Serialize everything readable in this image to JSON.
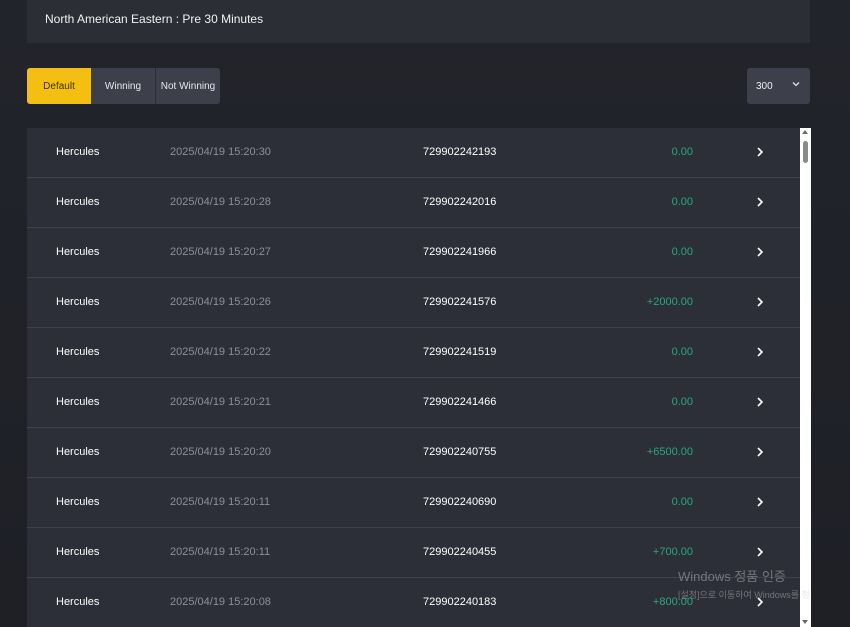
{
  "header": {
    "title": "North American Eastern : Pre 30 Minutes"
  },
  "filters": {
    "default": "Default",
    "winning": "Winning",
    "not_winning": "Not Winning"
  },
  "page_size": {
    "value": "300"
  },
  "colors": {
    "accent": "#f5bf11",
    "positive": "#27a77d",
    "row_bg": "#2d2f38"
  },
  "rows": [
    {
      "game": "Hercules",
      "time": "2025/04/19 15:20:30",
      "id": "729902242193",
      "amount": "0.00"
    },
    {
      "game": "Hercules",
      "time": "2025/04/19 15:20:28",
      "id": "729902242016",
      "amount": "0.00"
    },
    {
      "game": "Hercules",
      "time": "2025/04/19 15:20:27",
      "id": "729902241966",
      "amount": "0.00"
    },
    {
      "game": "Hercules",
      "time": "2025/04/19 15:20:26",
      "id": "729902241576",
      "amount": "+2000.00"
    },
    {
      "game": "Hercules",
      "time": "2025/04/19 15:20:22",
      "id": "729902241519",
      "amount": "0.00"
    },
    {
      "game": "Hercules",
      "time": "2025/04/19 15:20:21",
      "id": "729902241466",
      "amount": "0.00"
    },
    {
      "game": "Hercules",
      "time": "2025/04/19 15:20:20",
      "id": "729902240755",
      "amount": "+6500.00"
    },
    {
      "game": "Hercules",
      "time": "2025/04/19 15:20:11",
      "id": "729902240690",
      "amount": "0.00"
    },
    {
      "game": "Hercules",
      "time": "2025/04/19 15:20:11",
      "id": "729902240455",
      "amount": "+700.00"
    },
    {
      "game": "Hercules",
      "time": "2025/04/19 15:20:08",
      "id": "729902240183",
      "amount": "+800.00"
    }
  ],
  "watermark": {
    "title": "Windows 정품 인증",
    "subtitle": "[설정]으로 이동하여 Windows를 정"
  }
}
